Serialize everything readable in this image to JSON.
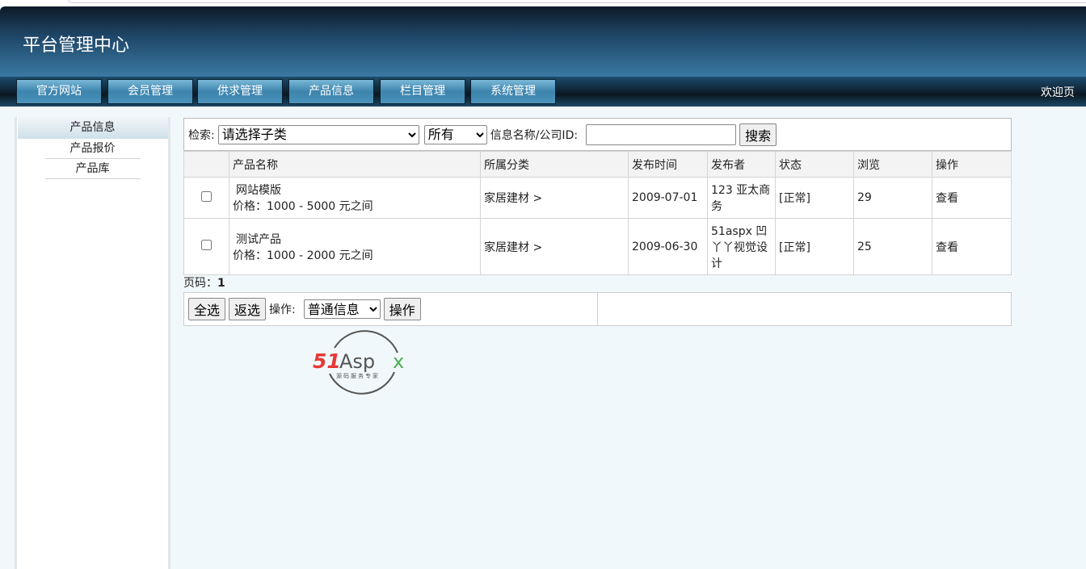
{
  "header": {
    "title": "平台管理中心",
    "welcome": "欢迎页"
  },
  "nav": [
    "官方网站",
    "会员管理",
    "供求管理",
    "产品信息",
    "栏目管理",
    "系统管理"
  ],
  "sidebar": {
    "items": [
      "产品信息",
      "产品报价",
      "产品库"
    ]
  },
  "search": {
    "label": "检索:",
    "category": "请选择子类",
    "scope": "所有",
    "name_label": "信息名称/公司ID:",
    "input_value": "",
    "button": "搜索"
  },
  "table": {
    "headers": [
      "",
      "产品名称",
      "所属分类",
      "发布时间",
      "发布者",
      "状态",
      "浏览",
      "操作"
    ],
    "rows": [
      {
        "name": "网站模版",
        "price": "价格：1000 - 5000 元之间",
        "category": "家居建材 >",
        "date": "2009-07-01",
        "publisher": "123 亚太商务",
        "status": "[正常]",
        "views": "29",
        "action": "查看"
      },
      {
        "name": "测试产品",
        "price": "价格：1000 - 2000 元之间",
        "category": "家居建材 >",
        "date": "2009-06-30",
        "publisher": "51aspx 凹丫丫视觉设计",
        "status": "[正常]",
        "views": "25",
        "action": "查看"
      }
    ]
  },
  "pager": {
    "label": "页码：",
    "page": "1"
  },
  "ops": {
    "select_all": "全选",
    "invert": "返选",
    "label": "操作:",
    "type": "普通信息",
    "submit": "操作"
  },
  "logo": {
    "text": "51Aspx",
    "tagline": "源码服务专家"
  }
}
